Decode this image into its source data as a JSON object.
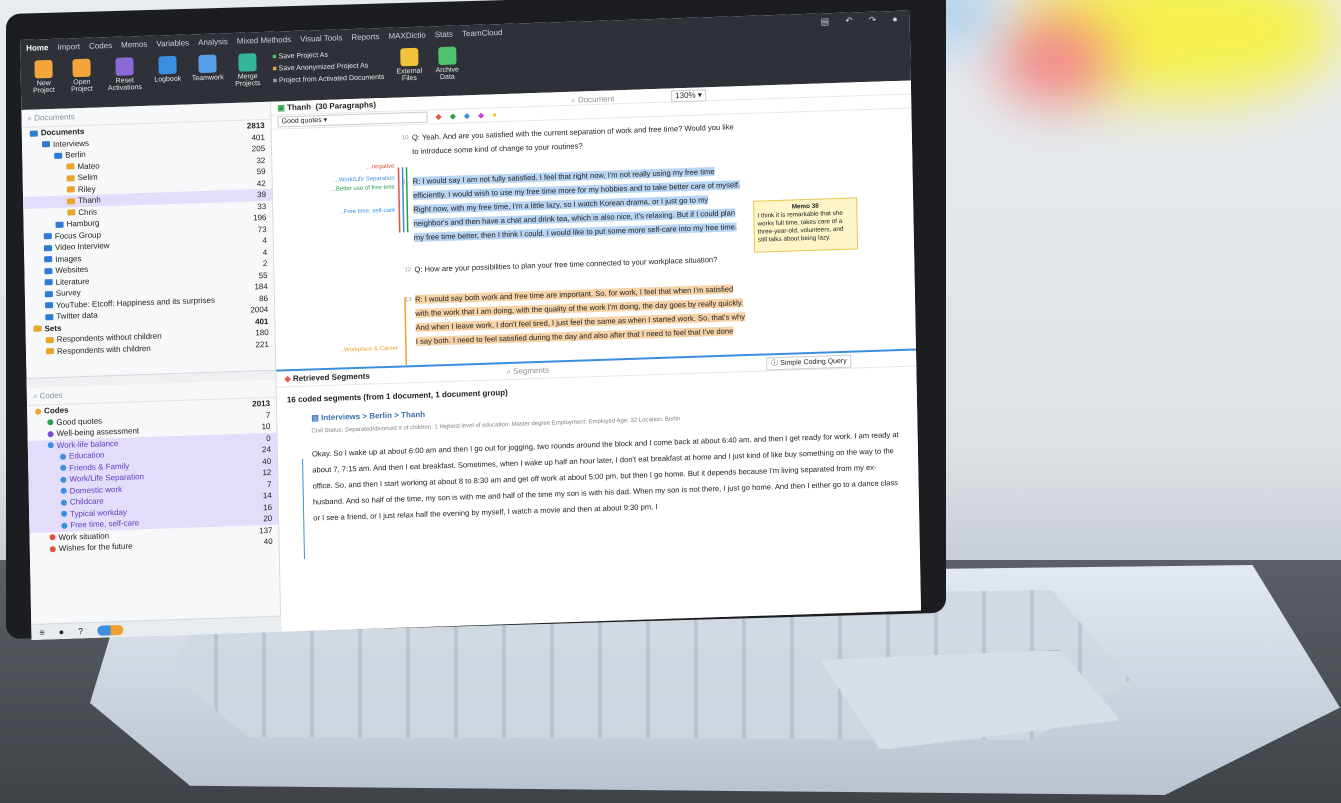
{
  "menu_tabs": [
    "Home",
    "Import",
    "Codes",
    "Memos",
    "Variables",
    "Analysis",
    "Mixed Methods",
    "Visual Tools",
    "Reports",
    "MAXDictio",
    "Stats",
    "TeamCloud"
  ],
  "ribbon": {
    "new_project": "New Project",
    "open_project": "Open Project",
    "reset_activations": "Reset Activations",
    "logbook": "Logbook",
    "teamwork": "Teamwork",
    "merge_projects": "Merge Projects",
    "save_as": "Save Project As",
    "save_anon": "Save Anonymized Project As",
    "from_activated": "Project from Activated Documents",
    "external_files": "External Files",
    "archive_data": "Archive Data"
  },
  "documents": {
    "search_placeholder": "Documents",
    "rows": [
      {
        "label": "Documents",
        "count": "2813",
        "bold": true,
        "indent": 0,
        "type": "root"
      },
      {
        "label": "Interviews",
        "count": "401",
        "indent": 1,
        "type": "folder"
      },
      {
        "label": "Berlin",
        "count": "205",
        "indent": 2,
        "type": "folder"
      },
      {
        "label": "Mateo",
        "count": "32",
        "indent": 3,
        "type": "doc"
      },
      {
        "label": "Selim",
        "count": "59",
        "indent": 3,
        "type": "doc"
      },
      {
        "label": "Riley",
        "count": "42",
        "indent": 3,
        "type": "doc"
      },
      {
        "label": "Thanh",
        "count": "39",
        "indent": 3,
        "type": "doc",
        "selected": true
      },
      {
        "label": "Chris",
        "count": "33",
        "indent": 3,
        "type": "doc"
      },
      {
        "label": "Hamburg",
        "count": "196",
        "indent": 2,
        "type": "folder"
      },
      {
        "label": "Focus Group",
        "count": "73",
        "indent": 1,
        "type": "folder"
      },
      {
        "label": "Video Interview",
        "count": "4",
        "indent": 1,
        "type": "folder"
      },
      {
        "label": "Images",
        "count": "4",
        "indent": 1,
        "type": "folder"
      },
      {
        "label": "Websites",
        "count": "2",
        "indent": 1,
        "type": "folder"
      },
      {
        "label": "Literature",
        "count": "55",
        "indent": 1,
        "type": "folder"
      },
      {
        "label": "Survey",
        "count": "184",
        "indent": 1,
        "type": "folder"
      },
      {
        "label": "YouTube: Etcoff: Happiness and its surprises",
        "count": "86",
        "indent": 1,
        "type": "folder"
      },
      {
        "label": "Twitter data",
        "count": "2004",
        "indent": 1,
        "type": "folder"
      },
      {
        "label": "Sets",
        "count": "401",
        "bold": true,
        "indent": 0,
        "type": "set"
      },
      {
        "label": "Respondents without children",
        "count": "180",
        "indent": 1,
        "type": "set"
      },
      {
        "label": "Respondents with children",
        "count": "221",
        "indent": 1,
        "type": "set"
      }
    ]
  },
  "codes": {
    "search_placeholder": "Codes",
    "rows": [
      {
        "label": "Codes",
        "count": "2013",
        "bold": true,
        "indent": 0,
        "color": "#e8a72a"
      },
      {
        "label": "Good quotes",
        "count": "7",
        "indent": 1,
        "color": "#2e9e4a"
      },
      {
        "label": "Well-being assessment",
        "count": "10",
        "indent": 1,
        "color": "#7a4ad8"
      },
      {
        "label": "Work-life balance",
        "count": "0",
        "indent": 1,
        "color": "#3a8fe0",
        "selected": true
      },
      {
        "label": "Education",
        "count": "24",
        "indent": 2,
        "color": "#3a8fe0",
        "selected": true
      },
      {
        "label": "Friends & Family",
        "count": "40",
        "indent": 2,
        "color": "#3a8fe0",
        "selected": true
      },
      {
        "label": "Work/Life Separation",
        "count": "12",
        "indent": 2,
        "color": "#3a8fe0",
        "selected": true
      },
      {
        "label": "Domestic work",
        "count": "7",
        "indent": 2,
        "color": "#3a8fe0",
        "selected": true
      },
      {
        "label": "Childcare",
        "count": "14",
        "indent": 2,
        "color": "#3a8fe0",
        "selected": true
      },
      {
        "label": "Typical workday",
        "count": "16",
        "indent": 2,
        "color": "#3a8fe0",
        "selected": true
      },
      {
        "label": "Free time, self-care",
        "count": "20",
        "indent": 2,
        "color": "#3a8fe0",
        "selected": true
      },
      {
        "label": "Work situation",
        "count": "137",
        "indent": 1,
        "color": "#e0523c"
      },
      {
        "label": "Wishes for the future",
        "count": "40",
        "indent": 1,
        "color": "#e0523c"
      }
    ]
  },
  "document_browser": {
    "title": "Thanh",
    "paragraphs": "(30 Paragraphs)",
    "code_select": "Good quotes",
    "search_placeholder": "Document",
    "zoom": "130%",
    "q1": "Q: Yeah. And are you satisfied with the current separation of work and free time? Would you like to introduce some kind of change to your routines?",
    "r1": "R: I would say I am not fully satisfied. I feel that right now, I'm not really using my free time efficiently. I would wish to use my free time more for my hobbies and to take better care of myself. Right now, with my free time, I'm a little lazy, so I watch Korean drama, or I just go to my neighbor's and then have a chat and drink tea, which is also nice, it's relaxing. But if I could plan my free time better, then I think I could. I would like to put some more self-care into my free time.",
    "q2": "Q: How are your possibilities to plan your free time connected to your workplace situation?",
    "r2": "R: I would say both work and free time are important. So, for work, I feel that when I'm satisfied with the work that I am doing, with the quality of the work I'm doing, the day goes by really quickly. And when I leave work, I don't feel tired, I just feel the same as when I started work. So, that's why I say both. I need to feel satisfied during the day and also after that I need to feel that I've done",
    "para_nums": [
      "10",
      "11",
      "12",
      "13"
    ],
    "margin_labels": [
      "...negative",
      "...Work/Life Separation",
      "...Better use of free time",
      "...Free time, self-care",
      "...Workplace & Career"
    ],
    "memo_title": "Memo 38",
    "memo_text": "I think it is remarkable that she works full time, takes care of a three-year-old, volunteers, and still talks about being lazy."
  },
  "retrieved": {
    "title": "Retrieved Segments",
    "search_placeholder": "Segments",
    "query_button": "Simple Coding Query",
    "summary": "16 coded segments (from 1 document, 1 document group)",
    "path": "Interviews > Berlin > Thanh",
    "meta": "Civil Status: Separated/divorced   # of children: 1   Highest level of education: Master degree   Employment: Employed   Age: 32   Location: Berlin",
    "segment": "Okay. So I wake up at about 6:00 am and then I go out for jogging, two rounds around the block and I come back at about 6:40 am, and then I get ready for work. I am ready at about 7, 7:15 am. And then I eat breakfast. Sometimes, when I wake up half an hour later, I don't eat breakfast at home and I just kind of like buy something on the way to the office. So, and then I start working at about 8 to 8:30 am and get off work at about 5:00 pm, but then I go home. But it depends because I'm living separated from my ex-husband. And so half of the time, my son is with me and half of the time my son is with his dad. When my son is not there, I just go home. And then I either go to a dance class or I see a friend, or I just relax half the evening by myself, I watch a movie and then at about 9:30 pm, I"
  },
  "colors": {
    "accent": "#3a8fe0",
    "ribbon_bg": "#2e3238",
    "selection": "#e3dcfa",
    "memo_bg": "#fff5c9"
  }
}
